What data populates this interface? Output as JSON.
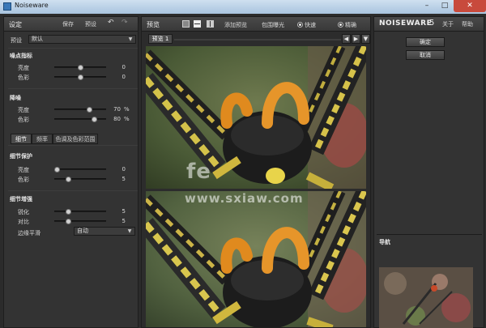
{
  "window": {
    "title": "Noiseware"
  },
  "left_panel": {
    "header": {
      "title": "设定",
      "save": "保存",
      "preset": "预设"
    },
    "preset_label": "预设",
    "preset_value": "默认",
    "noise_profile": {
      "title": "噪点指标",
      "rows": [
        {
          "label": "亮度",
          "value": "0",
          "level": 0.5
        },
        {
          "label": "色彩",
          "value": "0",
          "level": 0.5
        }
      ]
    },
    "noise_reduction": {
      "title": "降噪",
      "rows": [
        {
          "label": "亮度",
          "value": "70",
          "unit": "%",
          "level": 0.7
        },
        {
          "label": "色彩",
          "value": "80",
          "unit": "%",
          "level": 0.8
        }
      ]
    },
    "tabs": [
      "细节",
      "频率",
      "色调及色彩范围"
    ],
    "detail_protection": {
      "title": "细节保护",
      "rows": [
        {
          "label": "亮度",
          "value": "0",
          "level": 0.0
        },
        {
          "label": "色彩",
          "value": "5",
          "level": 0.25
        }
      ]
    },
    "detail_enhance": {
      "title": "细节增强",
      "rows": [
        {
          "label": "锐化",
          "value": "5",
          "level": 0.25
        },
        {
          "label": "对比",
          "value": "5",
          "level": 0.25
        }
      ],
      "edge_label": "边缘平滑",
      "edge_value": "自动"
    }
  },
  "center_panel": {
    "header": {
      "title": "预览",
      "add_preset": "添加预览",
      "clip_exposure": "包围曝光",
      "fast": "快速",
      "accurate": "精确"
    },
    "preview_tab": "预览 1",
    "watermark_top": "fe",
    "watermark": "www.sxiaw.com"
  },
  "right_panel": {
    "header": {
      "brand": "NOISEWARE",
      "version": "5",
      "about": "关于",
      "help": "帮助"
    },
    "ok": "确定",
    "cancel": "取消",
    "navigator": "导航"
  }
}
